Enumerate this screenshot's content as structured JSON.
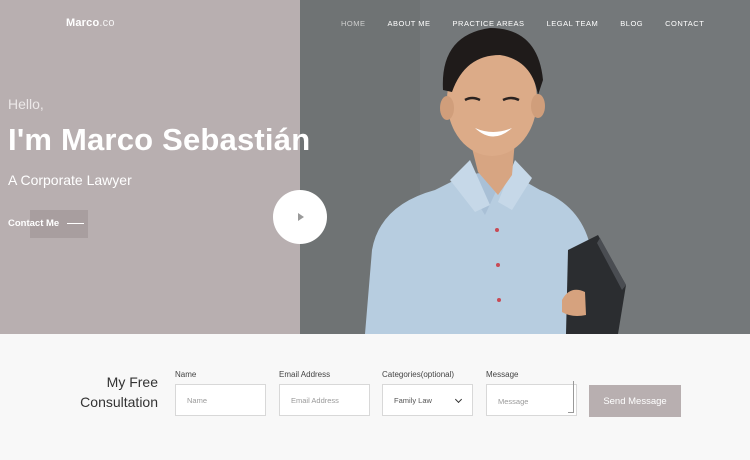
{
  "brand": {
    "name_main": "Marco",
    "name_suffix": ".co"
  },
  "nav": {
    "items": [
      {
        "label": "HOME",
        "active": true
      },
      {
        "label": "ABOUT ME"
      },
      {
        "label": "PRACTICE AREAS"
      },
      {
        "label": "LEGAL TEAM"
      },
      {
        "label": "BLOG"
      },
      {
        "label": "CONTACT"
      }
    ]
  },
  "hero": {
    "greeting": "Hello,",
    "headline": "I'm Marco Sebastián",
    "subtitle": "A Corporate Lawyer",
    "cta_label": "Contact Me",
    "play_icon": "play-icon"
  },
  "consultation": {
    "title_line1": "My Free",
    "title_line2": "Consultation",
    "fields": {
      "name": {
        "label": "Name",
        "placeholder": "Name"
      },
      "email": {
        "label": "Email Address",
        "placeholder": "Email Address"
      },
      "category": {
        "label": "Categories(optional)",
        "selected": "Family Law"
      },
      "message": {
        "label": "Message",
        "placeholder": "Message"
      }
    },
    "submit_label": "Send Message"
  },
  "colors": {
    "hero_left_bg": "#b8afb0",
    "hero_right_bg": "#75797a",
    "accent": "#b8afb0",
    "section_bg": "#f8f8f8"
  }
}
